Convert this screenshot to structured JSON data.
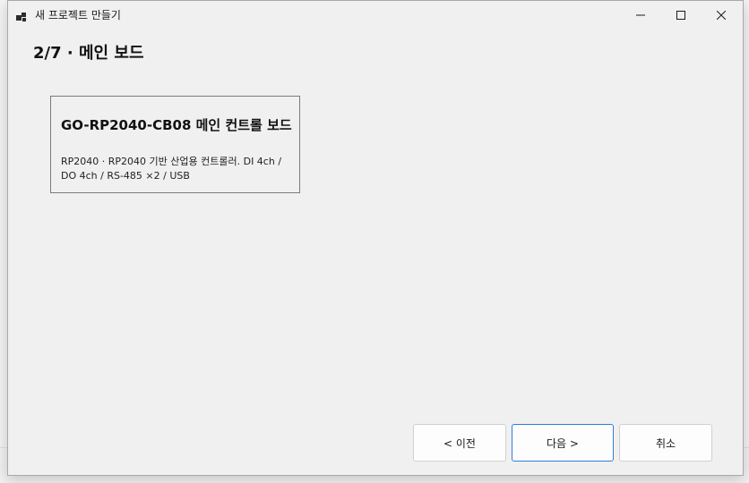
{
  "window": {
    "title": "새 프로젝트 만들기"
  },
  "wizard": {
    "step_heading": "2/7 · 메인 보드"
  },
  "board_card": {
    "title": "GO-RP2040-CB08 메인 컨트롤 보드",
    "description": "RP2040 · RP2040 기반 산업용 컨트롤러. DI 4ch / DO 4ch / RS-485 ×2 / USB"
  },
  "buttons": {
    "prev_label": "< 이전",
    "next_label": "다음 >",
    "cancel_label": "취소"
  },
  "icons": {
    "app": "app-window-icon",
    "minimize": "minimize-icon",
    "maximize": "maximize-icon",
    "close": "close-icon"
  },
  "colors": {
    "accent_border": "#2f7dd8",
    "window_bg": "#f0f0f0"
  }
}
